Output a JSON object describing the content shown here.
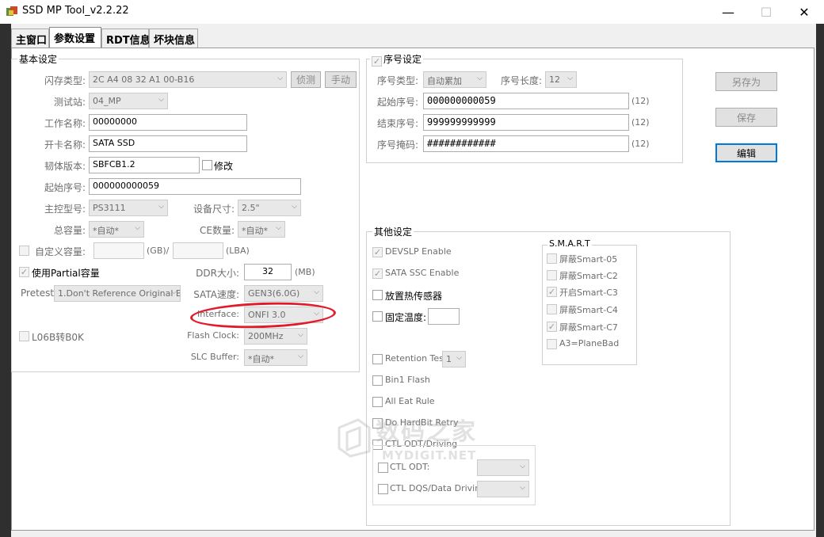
{
  "window": {
    "title": "SSD MP Tool_v2.2.22",
    "minimize": "—",
    "maximize": "☐",
    "close": "✕"
  },
  "tabs": [
    {
      "label": "主窗口"
    },
    {
      "label": "参数设置"
    },
    {
      "label": "RDT信息"
    },
    {
      "label": "坏块信息"
    }
  ],
  "basic": {
    "title": "基本设定",
    "flash_type": {
      "label": "闪存类型:",
      "value": "2C A4 08 32 A1 00-B16",
      "detect": "侦测",
      "manual": "手动"
    },
    "station": {
      "label": "测试站:",
      "value": "04_MP"
    },
    "work_name": {
      "label": "工作名称:",
      "value": "00000000"
    },
    "card_name": {
      "label": "开卡名称:",
      "value": "SATA SSD"
    },
    "firmware": {
      "label": "韧体版本:",
      "value": "SBFCB1.2",
      "modify": "修改"
    },
    "start_sn": {
      "label": "起始序号:",
      "value": "000000000059"
    },
    "controller": {
      "label": "主控型号:",
      "value": "PS3111"
    },
    "device_size": {
      "label": "设备尺寸:",
      "value": "2.5\""
    },
    "total_capacity": {
      "label": "总容量:",
      "value": "*自动*"
    },
    "ce_count": {
      "label": "CE数量:",
      "value": "*自动*"
    },
    "custom_capacity": {
      "label": "自定义容量:",
      "gb": "(GB)/",
      "lba": "(LBA)"
    },
    "partial": {
      "label": "使用Partial容量"
    },
    "ddr_size": {
      "label": "DDR大小:",
      "value": "32",
      "unit": "(MB)"
    },
    "pretest": {
      "label": "Pretest:",
      "value": "1.Don't Reference Original B"
    },
    "sata_speed": {
      "label": "SATA速度:",
      "value": "GEN3(6.0G)"
    },
    "interface": {
      "label": "Interface:",
      "value": "ONFI 3.0"
    },
    "l06b": {
      "label": "L06B转B0K"
    },
    "flash_clock": {
      "label": "Flash Clock:",
      "value": "200MHz"
    },
    "slc_buffer": {
      "label": "SLC Buffer:",
      "value": "*自动*"
    }
  },
  "serial": {
    "title": "序号设定",
    "type": {
      "label": "序号类型:",
      "value": "自动累加"
    },
    "length": {
      "label": "序号长度:",
      "value": "12"
    },
    "start": {
      "label": "起始序号:",
      "value": "000000000059",
      "count": "(12)"
    },
    "end": {
      "label": "结束序号:",
      "value": "999999999999",
      "count": "(12)"
    },
    "mask": {
      "label": "序号掩码:",
      "value": "############",
      "count": "(12)"
    }
  },
  "actions": {
    "save_as": "另存为",
    "save": "保存",
    "edit": "编辑"
  },
  "other": {
    "title": "其他设定",
    "devslp": "DEVSLP Enable",
    "sata_ssc": "SATA SSC Enable",
    "thermal": "放置热传感器",
    "fixed_temp": "固定温度:",
    "retention": {
      "label": "Retention Test",
      "value": "1"
    },
    "bin1": "Bin1 Flash",
    "all_eat": "All Eat Rule",
    "hardbit": "Do HardBit Retry",
    "ctl_odt_driving": "CTL ODT/Driving",
    "ctl_odt": "CTL ODT:",
    "ctl_dqs": "CTL DQS/Data Driving:",
    "smart": {
      "title": "S.M.A.R.T",
      "items": [
        {
          "label": "屏蔽Smart-05",
          "checked": ""
        },
        {
          "label": "屏蔽Smart-C2",
          "checked": ""
        },
        {
          "label": "开启Smart-C3",
          "checked": "✓"
        },
        {
          "label": "屏蔽Smart-C4",
          "checked": ""
        },
        {
          "label": "屏蔽Smart-C7",
          "checked": "✓"
        },
        {
          "label": "A3=PlaneBad",
          "checked": ""
        }
      ]
    }
  },
  "check": "✓",
  "arrow": "⌵",
  "watermark": {
    "cn": "数码之家",
    "en": "MYDIGIT.NET"
  }
}
